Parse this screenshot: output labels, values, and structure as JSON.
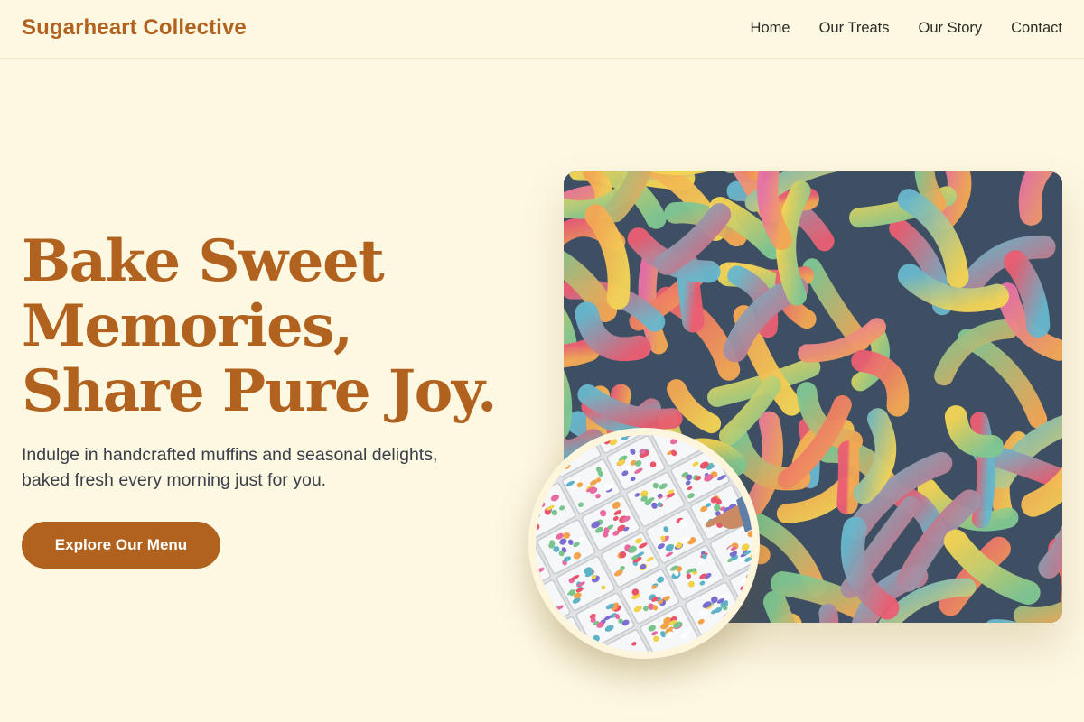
{
  "header": {
    "brand": "Sugarheart Collective",
    "nav": [
      {
        "label": "Home"
      },
      {
        "label": "Our Treats"
      },
      {
        "label": "Our Story"
      },
      {
        "label": "Contact"
      }
    ]
  },
  "hero": {
    "title_lines": [
      "Bake Sweet",
      "Memories,",
      "Share Pure Joy."
    ],
    "subtitle_lines": [
      "Indulge in handcrafted muffins and seasonal delights,",
      "baked fresh every morning just for you."
    ],
    "cta_label": "Explore Our Menu"
  },
  "images": {
    "main": {
      "subject": "sour gummy worms"
    },
    "inset": {
      "subject": "candy bins"
    }
  },
  "colors": {
    "background": "#fdf8e2",
    "brand": "#b2621f",
    "text": "#3a3f4a"
  }
}
